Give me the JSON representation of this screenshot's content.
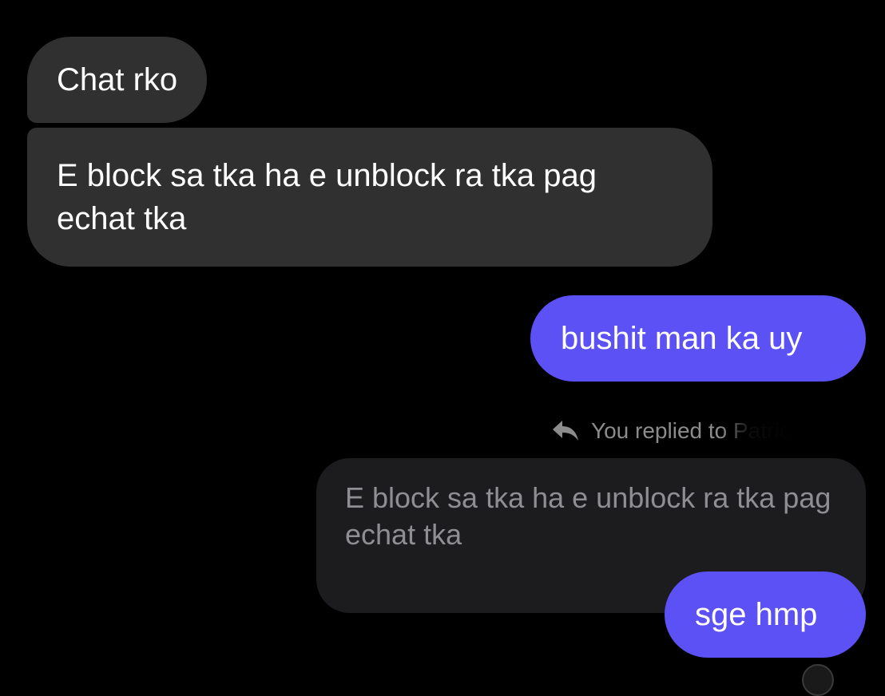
{
  "conversation": {
    "messages": [
      {
        "sender": "other",
        "text": "Chat rko"
      },
      {
        "sender": "other",
        "text": "E block sa tka ha e unblock ra tka pag echat tka"
      },
      {
        "sender": "me",
        "text": "bushit man ka uy"
      }
    ],
    "reply": {
      "indicator_label": "You replied to Patrick",
      "icon": "reply-arrow-icon",
      "quoted_text": "E block sa tka ha e unblock ra tka pag echat tka",
      "reply_text": "sge hmp"
    }
  },
  "colors": {
    "background": "#000000",
    "incoming_bubble": "#303030",
    "outgoing_bubble": "#5B51F5",
    "quoted_bubble": "#1c1c1e",
    "quoted_text": "#8e8e93"
  }
}
